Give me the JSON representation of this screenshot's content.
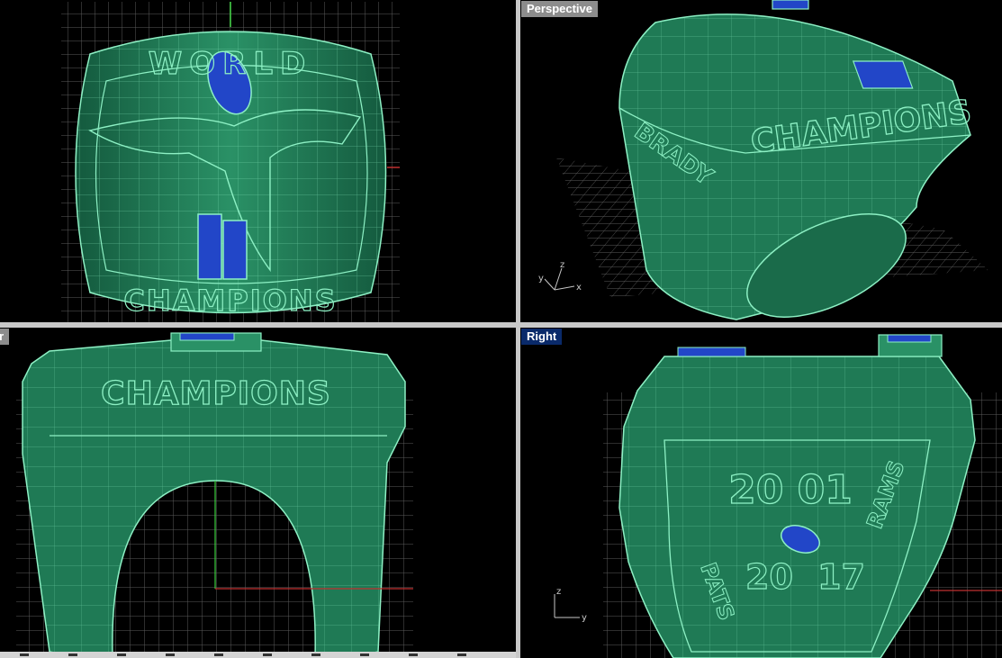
{
  "viewports": {
    "top": {
      "label": ""
    },
    "perspective": {
      "label": "Perspective"
    },
    "front": {
      "label": "ger"
    },
    "right": {
      "label": "Right"
    }
  },
  "ring_text": {
    "champions": "CHAMPIONS",
    "world": "WORLD",
    "year": "20 01",
    "right_left_word": "PATS",
    "right_score_1": "20",
    "right_score_2": "17",
    "right_right_word": "RAMS",
    "persp_side": "BRADY"
  },
  "axes": {
    "x": "x",
    "y": "y",
    "z": "z"
  },
  "colors": {
    "viewport_bg": "#000000",
    "ring_fill": "#1f7a55",
    "wire": "#6fe0b0",
    "grid": "#6b6b6b",
    "gem": "#2246c8",
    "active_label_bg": "#0a2a6a",
    "inactive_label_bg": "#8c8c8c"
  }
}
